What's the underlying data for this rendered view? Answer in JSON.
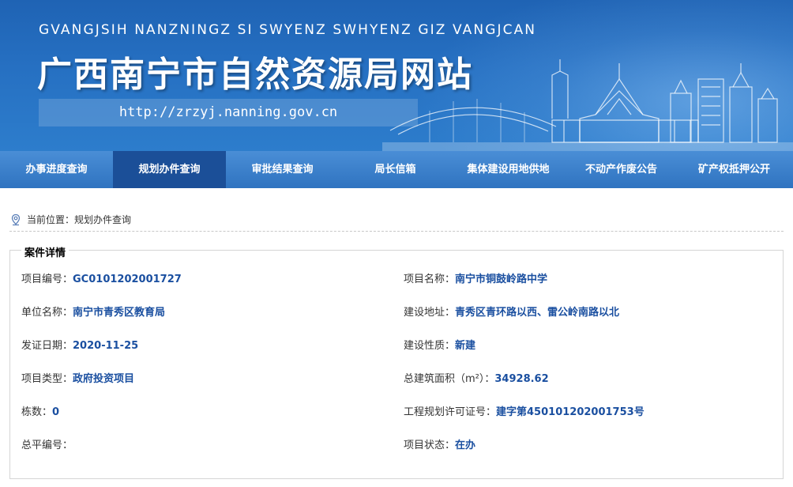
{
  "site": {
    "pinyin": "GVANGJSIH NANZNINGZ SI SWYENZ SWHYENZ GIZ VANGJCAN",
    "title": "广西南宁市自然资源局网站",
    "url": "http://zrzyj.nanning.gov.cn"
  },
  "nav": {
    "items": [
      {
        "label": "办事进度查询"
      },
      {
        "label": "规划办件查询"
      },
      {
        "label": "审批结果查询"
      },
      {
        "label": "局长信箱"
      },
      {
        "label": "集体建设用地供地"
      },
      {
        "label": "不动产作废公告"
      },
      {
        "label": "矿产权抵押公开"
      }
    ],
    "active_index": 1
  },
  "breadcrumb": {
    "prefix": "当前位置：",
    "current": "规划办件查询"
  },
  "case": {
    "legend": "案件详情",
    "rows": [
      {
        "left": {
          "label": "项目编号：",
          "value": "GC0101202001727"
        },
        "right": {
          "label": "项目名称：",
          "value": "南宁市铜鼓岭路中学"
        }
      },
      {
        "left": {
          "label": "单位名称：",
          "value": "南宁市青秀区教育局"
        },
        "right": {
          "label": "建设地址：",
          "value": "青秀区青环路以西、雷公岭南路以北"
        }
      },
      {
        "left": {
          "label": "发证日期：",
          "value": "2020-11-25"
        },
        "right": {
          "label": "建设性质：",
          "value": "新建"
        }
      },
      {
        "left": {
          "label": "项目类型：",
          "value": "政府投资项目"
        },
        "right": {
          "label": "总建筑面积（m²）：",
          "value": "34928.62"
        }
      },
      {
        "left": {
          "label": "栋数：",
          "value": "0"
        },
        "right": {
          "label": "工程规划许可证号：",
          "value": "建字第450101202001753号"
        }
      },
      {
        "left": {
          "label": "总平编号：",
          "value": ""
        },
        "right": {
          "label": "项目状态：",
          "value": "在办"
        }
      }
    ]
  },
  "colors": {
    "banner_top": "#1f63b4",
    "nav_active": "#1b4f98",
    "value_text": "#1a4fa0"
  }
}
